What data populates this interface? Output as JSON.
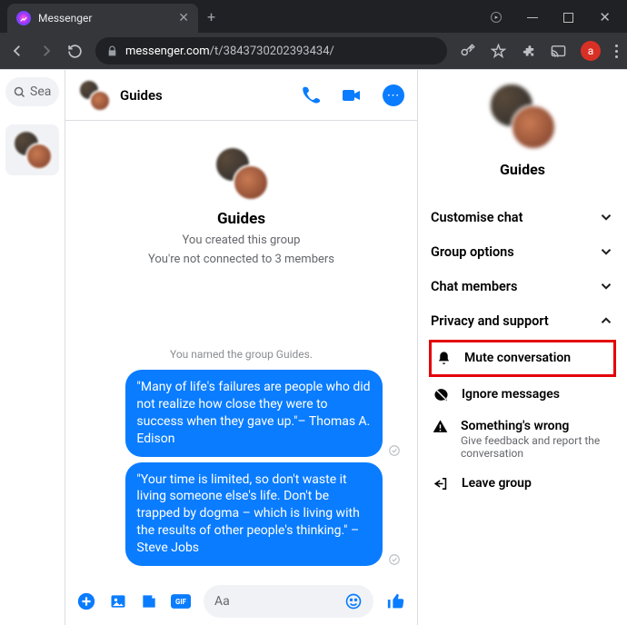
{
  "browser": {
    "tab_title": "Messenger",
    "url_host": "messenger.com",
    "url_path": "/t/3843730202393434/",
    "profile_letter": "a"
  },
  "left": {
    "search_placeholder": "Sea"
  },
  "chat": {
    "title": "Guides",
    "intro_title": "Guides",
    "intro_line1": "You created this group",
    "intro_line2": "You're not connected to 3 members",
    "system_msg": "You named the group Guides.",
    "messages": [
      "\"Many of life's failures are people who did not realize how close they were to success when they gave up.\"– Thomas A. Edison",
      "\"Your time is limited, so don't waste it living someone else's life. Don't be trapped by dogma – which is living with the results of other people's thinking.\" – Steve Jobs"
    ],
    "composer_placeholder": "Aa"
  },
  "right": {
    "title": "Guides",
    "sections": {
      "customise": "Customise chat",
      "group": "Group options",
      "members": "Chat members",
      "privacy": "Privacy and support"
    },
    "items": {
      "mute": "Mute conversation",
      "ignore": "Ignore messages",
      "wrong_title": "Something's wrong",
      "wrong_desc": "Give feedback and report the conversation",
      "leave": "Leave group"
    }
  }
}
